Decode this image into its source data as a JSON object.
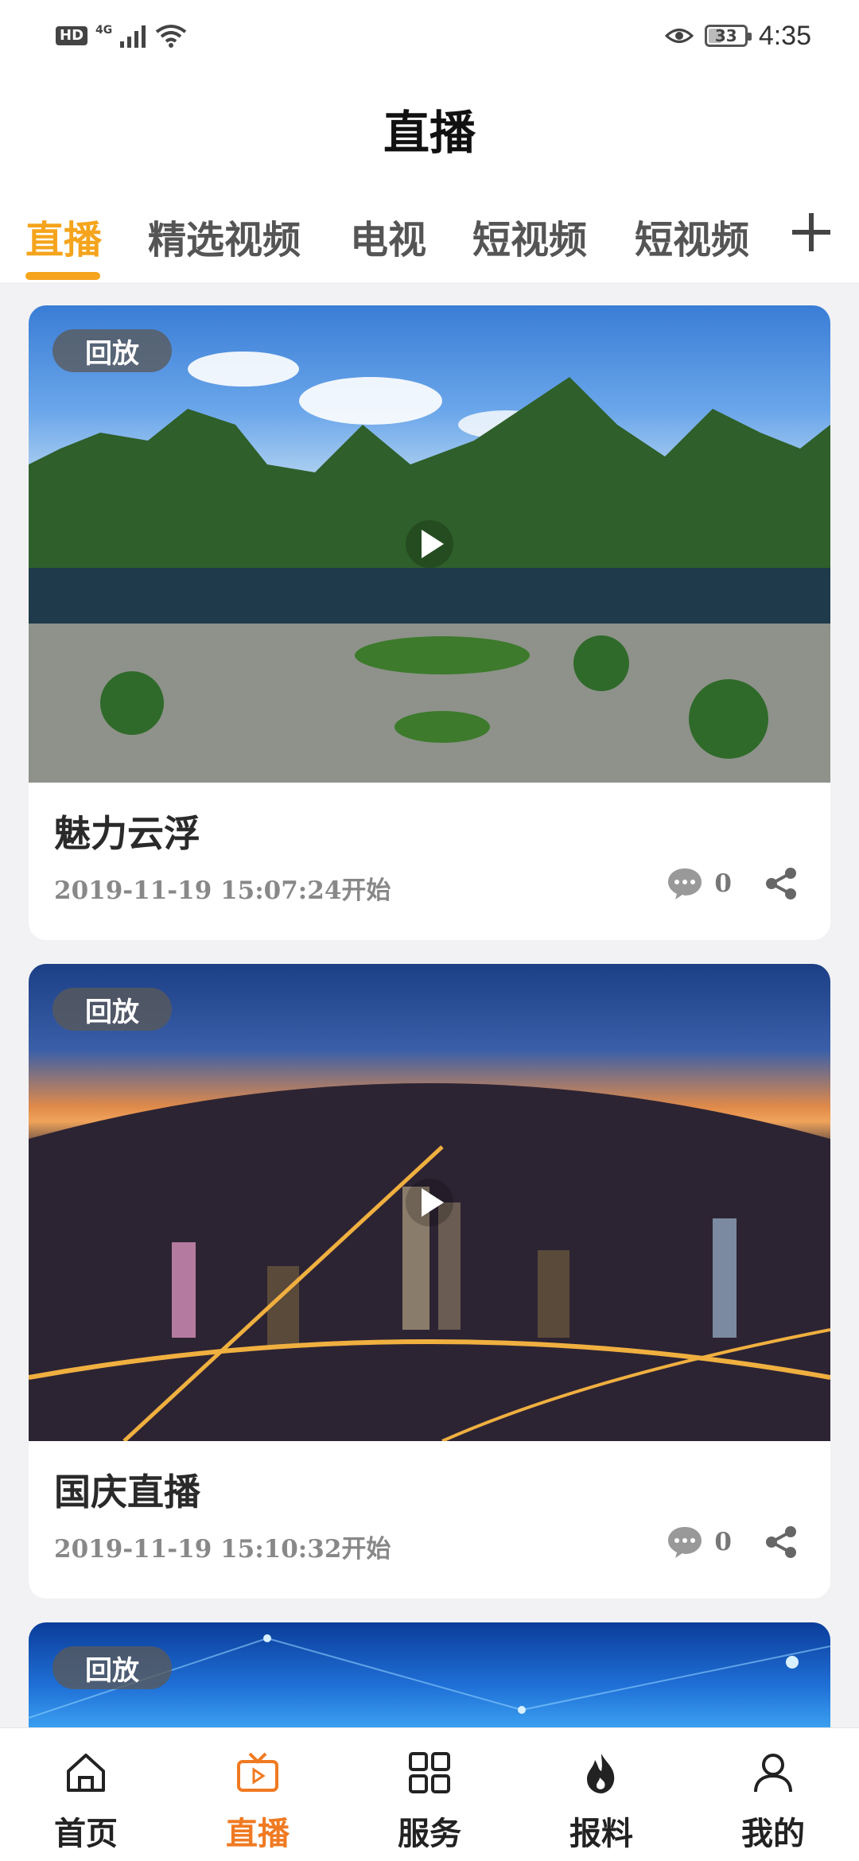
{
  "status_bar": {
    "hd": "HD",
    "network": "4G",
    "battery": "33",
    "time": "4:35"
  },
  "page": {
    "title": "直播"
  },
  "tabs": [
    {
      "label": "直播",
      "active": true
    },
    {
      "label": "精选视频",
      "active": false
    },
    {
      "label": "电视",
      "active": false
    },
    {
      "label": "短视频",
      "active": false
    },
    {
      "label": "短视频",
      "active": false
    }
  ],
  "add_tab_icon": "plus-icon",
  "cards": [
    {
      "badge": "回放",
      "title": "魅力云浮",
      "time": "2019-11-19 15:07:24开始",
      "comments": "0"
    },
    {
      "badge": "回放",
      "title": "国庆直播",
      "time": "2019-11-19 15:10:32开始",
      "comments": "0"
    },
    {
      "badge": "回放"
    }
  ],
  "bottom_nav": [
    {
      "label": "首页",
      "icon": "home-icon",
      "active": false
    },
    {
      "label": "直播",
      "icon": "tv-live-icon",
      "active": true
    },
    {
      "label": "服务",
      "icon": "grid-icon",
      "active": false
    },
    {
      "label": "报料",
      "icon": "flame-icon",
      "active": false
    },
    {
      "label": "我的",
      "icon": "user-icon",
      "active": false
    }
  ],
  "colors": {
    "accent": "#f5a41c",
    "nav_active": "#f07a22",
    "background": "#f2f2f4"
  }
}
